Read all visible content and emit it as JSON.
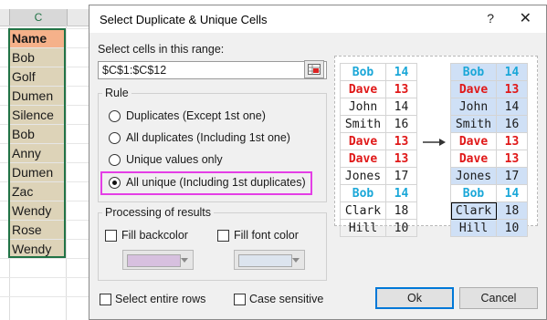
{
  "sheet": {
    "column_letter": "C",
    "cells": [
      "Name",
      "Bob",
      "Golf",
      "Dumen",
      "Silence",
      "Bob",
      "Anny",
      "Dumen",
      "Zac",
      "Wendy",
      "Rose",
      "Wendy"
    ]
  },
  "dialog": {
    "title": "Select Duplicate & Unique Cells",
    "help_glyph": "?",
    "close_glyph": "✕",
    "range_label": "Select cells in this range:",
    "range_value": "$C$1:$C$12",
    "rule": {
      "title": "Rule",
      "options": [
        "Duplicates (Except 1st one)",
        "All duplicates (Including 1st one)",
        "Unique values only",
        "All unique (Including 1st duplicates)"
      ],
      "selected_index": 3
    },
    "processing": {
      "title": "Processing of results",
      "fill_backcolor": "Fill backcolor",
      "fill_font_color": "Fill font color",
      "backcolor_swatch": "#d7c0df",
      "fontcolor_swatch": "#dce4ee"
    },
    "select_entire_rows": "Select entire rows",
    "case_sensitive": "Case sensitive",
    "ok": "Ok",
    "cancel": "Cancel"
  },
  "preview": {
    "left": [
      {
        "name": "Bob",
        "value": "14",
        "style": "cyan"
      },
      {
        "name": "Dave",
        "value": "13",
        "style": "red"
      },
      {
        "name": "John",
        "value": "14",
        "style": "plain"
      },
      {
        "name": "Smith",
        "value": "16",
        "style": "plain"
      },
      {
        "name": "Dave",
        "value": "13",
        "style": "red"
      },
      {
        "name": "Dave",
        "value": "13",
        "style": "red"
      },
      {
        "name": "Jones",
        "value": "17",
        "style": "plain"
      },
      {
        "name": "Bob",
        "value": "14",
        "style": "cyan"
      },
      {
        "name": "Clark",
        "value": "18",
        "style": "plain"
      },
      {
        "name": "Hill",
        "value": "10",
        "style": "plain"
      }
    ],
    "right": [
      {
        "name": "Bob",
        "value": "14",
        "style": "cyan",
        "highlight": true
      },
      {
        "name": "Dave",
        "value": "13",
        "style": "red",
        "highlight": true
      },
      {
        "name": "John",
        "value": "14",
        "style": "plain",
        "highlight": true
      },
      {
        "name": "Smith",
        "value": "16",
        "style": "plain",
        "highlight": true
      },
      {
        "name": "Dave",
        "value": "13",
        "style": "red",
        "highlight": false
      },
      {
        "name": "Dave",
        "value": "13",
        "style": "red",
        "highlight": false
      },
      {
        "name": "Jones",
        "value": "17",
        "style": "plain",
        "highlight": true
      },
      {
        "name": "Bob",
        "value": "14",
        "style": "cyan",
        "highlight": false
      },
      {
        "name": "Clark",
        "value": "18",
        "style": "plain",
        "highlight": true
      },
      {
        "name": "Hill",
        "value": "10",
        "style": "plain",
        "highlight": true
      }
    ]
  }
}
